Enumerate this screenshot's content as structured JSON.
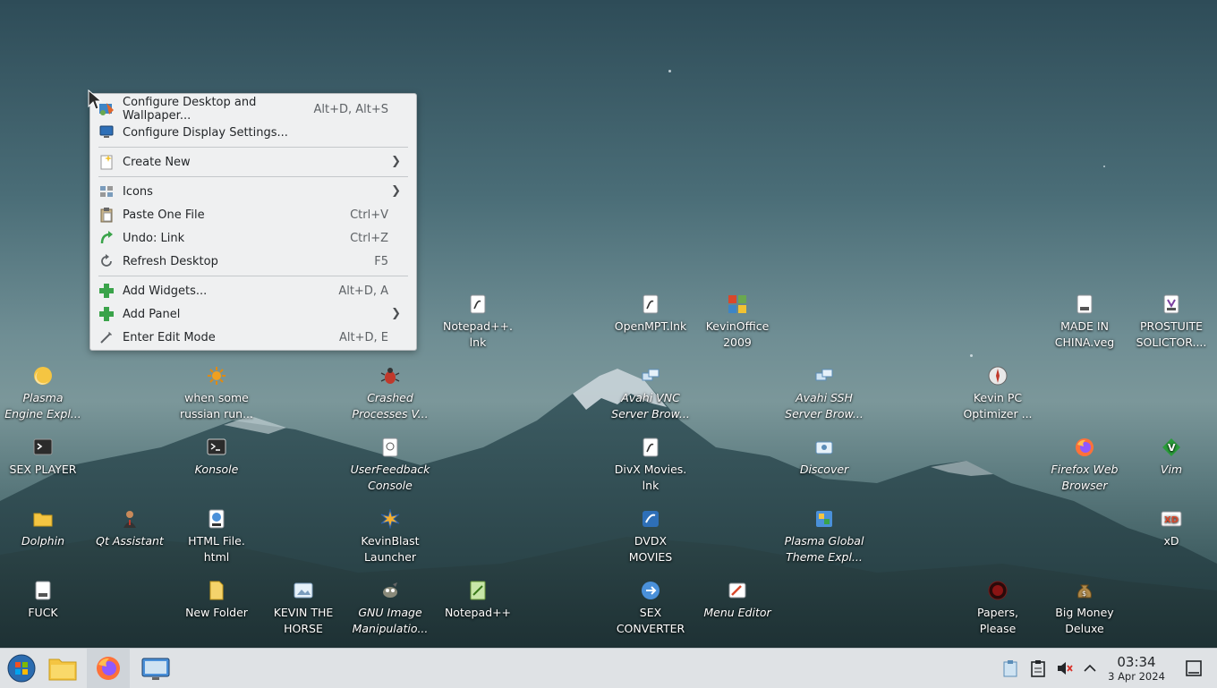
{
  "context_menu": {
    "items": [
      {
        "label": "Configure Desktop and Wallpaper...",
        "shortcut": "Alt+D, Alt+S",
        "icon": "configure-desktop-icon"
      },
      {
        "label": "Configure Display Settings...",
        "shortcut": "",
        "icon": "display-settings-icon"
      },
      {
        "label": "Create New",
        "submenu": true,
        "icon": "create-new-icon"
      },
      {
        "label": "Icons",
        "submenu": true,
        "icon": "icons-icon"
      },
      {
        "label": "Paste One File",
        "shortcut": "Ctrl+V",
        "icon": "paste-icon"
      },
      {
        "label": "Undo: Link",
        "shortcut": "Ctrl+Z",
        "icon": "undo-icon"
      },
      {
        "label": "Refresh Desktop",
        "shortcut": "F5",
        "icon": "refresh-icon"
      },
      {
        "label": "Add Widgets...",
        "shortcut": "Alt+D, A",
        "icon": "add-widgets-icon"
      },
      {
        "label": "Add Panel",
        "submenu": true,
        "icon": "add-panel-icon"
      },
      {
        "label": "Enter Edit Mode",
        "shortcut": "Alt+D, E",
        "icon": "edit-mode-icon"
      }
    ]
  },
  "desktop_icons": {
    "notepadpp_lnk": "Notepad++.\nlnk",
    "openmpt": "OpenMPT.lnk",
    "kevinoffice": "KevinOffice\n2009",
    "made_in_china": "MADE IN\nCHINA.veg",
    "prostuite": "PROSTUITE\nSOLICTOR....",
    "plasma_engine": "Plasma\nEngine Expl...",
    "russian": "when some\nrussian run...",
    "crashed": "Crashed\nProcesses V...",
    "avahi_vnc": "Avahi VNC\nServer Brow...",
    "avahi_ssh": "Avahi SSH\nServer Brow...",
    "kevin_pc": "Kevin PC\nOptimizer ...",
    "sex_player": "SEX PLAYER",
    "konsole": "Konsole",
    "userfeedback": "UserFeedback\nConsole",
    "divx": "DivX Movies.\nlnk",
    "discover": "Discover",
    "firefox": "Firefox Web\nBrowser",
    "vim": "Vim",
    "dolphin": "Dolphin",
    "qt_assistant": "Qt Assistant",
    "html_file": "HTML File.\nhtml",
    "kevinblast": "KevinBlast\nLauncher",
    "dvdx": "DVDX\nMOVIES",
    "plasma_global": "Plasma Global\nTheme Expl...",
    "xd": "xD",
    "fuck": "FUCK",
    "new_folder": "New Folder",
    "kevin_horse": "KEVIN THE\nHORSE",
    "gimp": "GNU Image\nManipulatio...",
    "notepadpp": "Notepad++",
    "sex_converter": "SEX\nCONVERTER",
    "menu_editor": "Menu Editor",
    "papers_please": "Papers,\nPlease",
    "big_money": "Big Money\nDeluxe"
  },
  "taskbar": {
    "time": "03:34",
    "date": "3 Apr 2024",
    "launchers": [
      "start-menu-icon",
      "file-manager-icon",
      "firefox-icon",
      "desktop-pager-icon"
    ],
    "tray": [
      "clipboard-icon",
      "notes-icon",
      "volume-muted-icon",
      "show-hidden-icon"
    ]
  }
}
